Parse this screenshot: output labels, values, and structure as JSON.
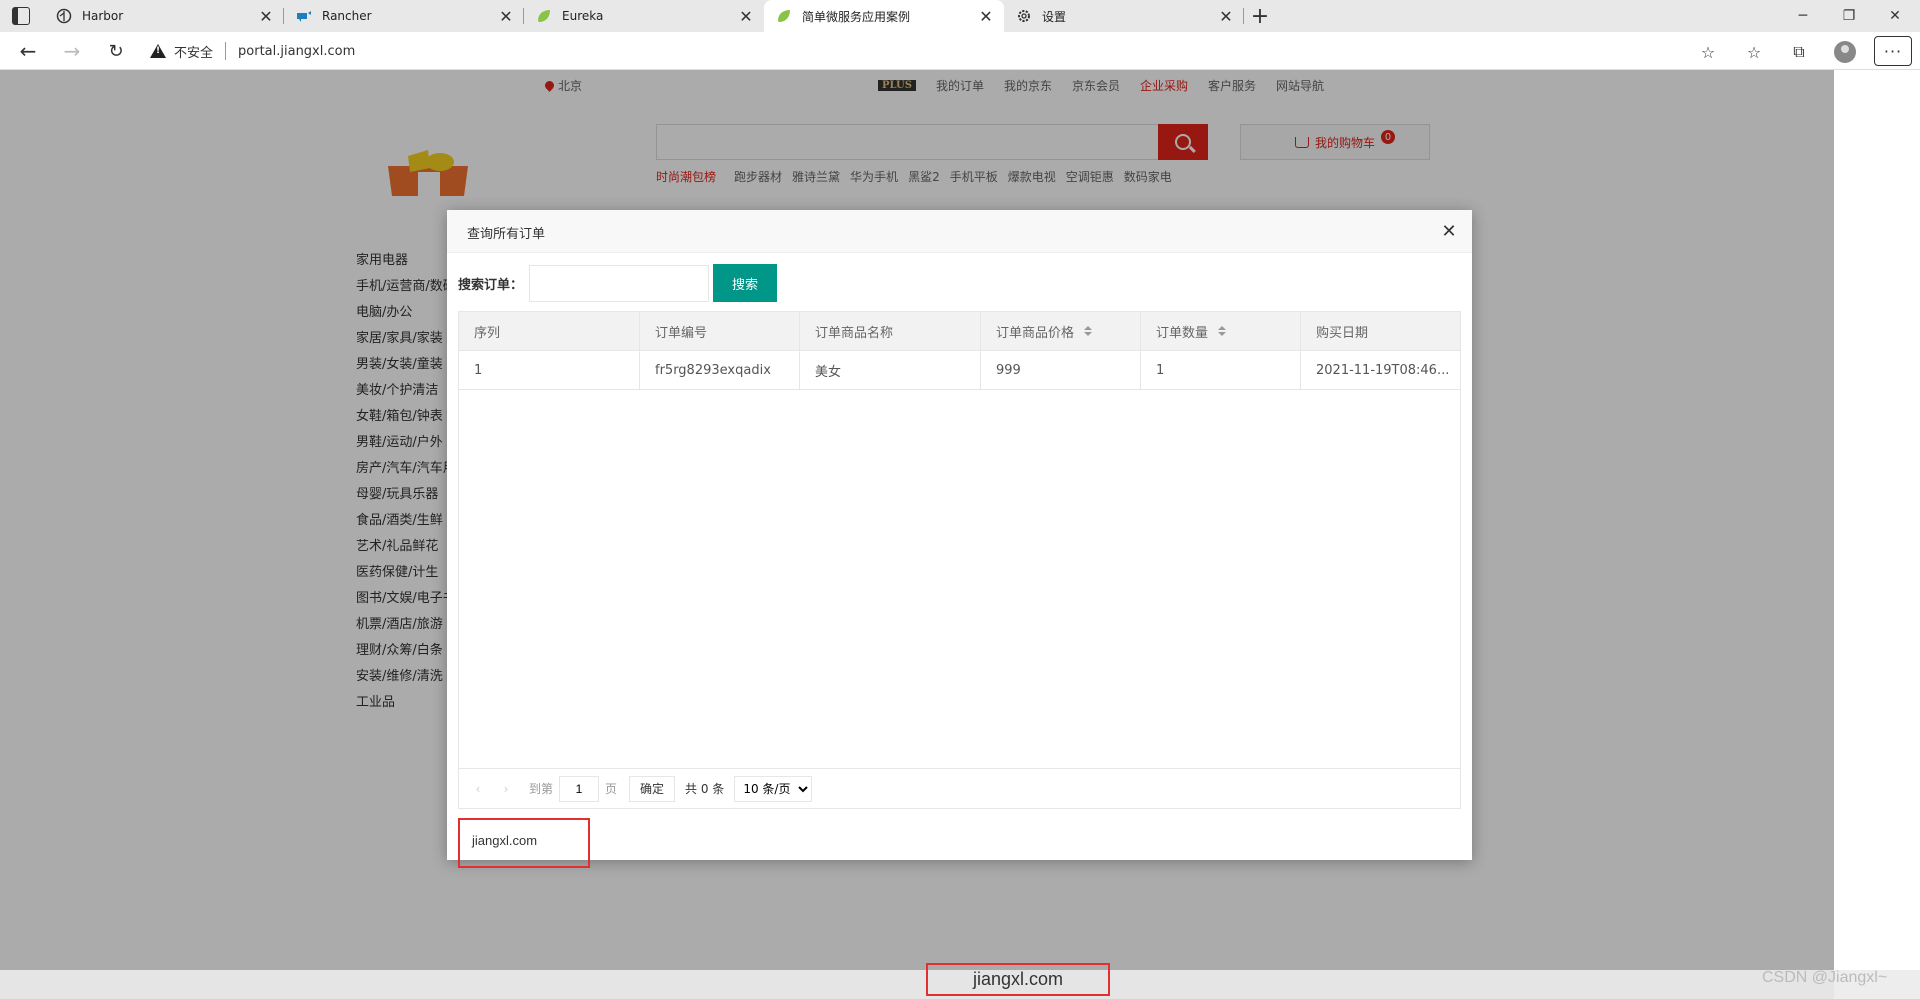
{
  "browser": {
    "tabs": [
      {
        "title": "Harbor"
      },
      {
        "title": "Rancher"
      },
      {
        "title": "Eureka"
      },
      {
        "title": "简单微服务应用案例"
      },
      {
        "title": "设置"
      }
    ],
    "security_label": "不安全",
    "url": "portal.jiangxl.com"
  },
  "shop": {
    "location": "北京",
    "nav_links": [
      "我的订单",
      "我的京东",
      "京东会员",
      "企业采购",
      "客户服务",
      "网站导航"
    ],
    "plus_label": "PLUS",
    "cart_label": "我的购物车",
    "cart_count": "0",
    "hotwords": [
      "时尚潮包榜",
      "跑步器材",
      "雅诗兰黛",
      "华为手机",
      "黑鲨2",
      "手机平板",
      "爆款电视",
      "空调钜惠",
      "数码家电"
    ],
    "categories": [
      "家用电器",
      "手机/运营商/数码",
      "电脑/办公",
      "家居/家具/家装",
      "男装/女装/童装",
      "美妆/个护清洁",
      "女鞋/箱包/钟表",
      "男鞋/运动/户外",
      "房产/汽车/汽车用品",
      "母婴/玩具乐器",
      "食品/酒类/生鲜",
      "艺术/礼品鲜花",
      "医药保健/计生",
      "图书/文娱/电子书",
      "机票/酒店/旅游",
      "理财/众筹/白条",
      "安装/维修/清洗",
      "工业品"
    ]
  },
  "modal": {
    "title": "查询所有订单",
    "search_label": "搜索订单：",
    "search_value": "",
    "search_button": "搜索",
    "columns": [
      "序列",
      "订单编号",
      "订单商品名称",
      "订单商品价格",
      "订单数量",
      "购买日期"
    ],
    "rows": [
      [
        "1",
        "fr5rg8293exqadix",
        "美女",
        "999",
        "1",
        "2021-11-19T08:46..."
      ]
    ],
    "pager": {
      "goto_label": "到第",
      "page_value": "1",
      "page_unit": "页",
      "confirm": "确定",
      "total": "共 0 条",
      "page_size": "10 条/页"
    },
    "watermark": "jiangxl.com"
  },
  "watermark_bottom": "jiangxl.com",
  "csdn_watermark": "CSDN @Jiangxl~",
  "colors": {
    "brand_red": "#e2231a",
    "primary_teal": "#009688",
    "watermark_border": "#e03030"
  }
}
